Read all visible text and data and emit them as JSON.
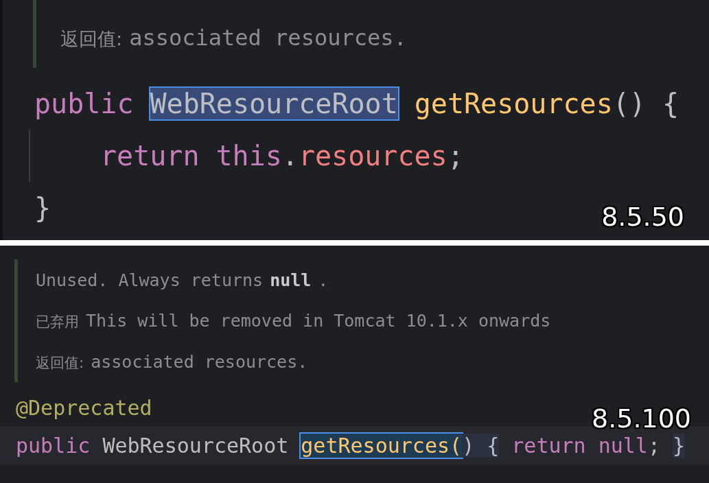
{
  "panels": [
    {
      "version": "8.5.50",
      "doc": [
        {
          "parts": [
            {
              "kind": "label",
              "text": "返回值:"
            },
            {
              "kind": "text",
              "text": "associated resources."
            }
          ]
        }
      ],
      "code": [
        {
          "indent": false,
          "current": false,
          "tokens": [
            {
              "kind": "keyword",
              "text": "public",
              "gap": false,
              "selected": false,
              "folded": false
            },
            {
              "kind": "type",
              "text": "WebResourceRoot",
              "gap": true,
              "selected": true,
              "folded": false
            },
            {
              "kind": "method",
              "text": "getResources",
              "gap": true,
              "selected": false,
              "folded": false
            },
            {
              "kind": "punct",
              "text": "()",
              "gap": false,
              "selected": false,
              "folded": false
            },
            {
              "kind": "punct",
              "text": "{",
              "gap": true,
              "selected": false,
              "folded": false
            }
          ]
        },
        {
          "indent": true,
          "current": false,
          "tokens": [
            {
              "kind": "keyword",
              "text": "return",
              "gap": false,
              "selected": false,
              "folded": false
            },
            {
              "kind": "keyword",
              "text": "this",
              "gap": true,
              "selected": false,
              "folded": false
            },
            {
              "kind": "punct",
              "text": ".",
              "gap": false,
              "selected": false,
              "folded": false
            },
            {
              "kind": "field",
              "text": "resources",
              "gap": false,
              "selected": false,
              "folded": false
            },
            {
              "kind": "punct",
              "text": ";",
              "gap": false,
              "selected": false,
              "folded": false
            }
          ]
        },
        {
          "indent": false,
          "current": false,
          "tokens": [
            {
              "kind": "punct",
              "text": "}",
              "gap": false,
              "selected": false,
              "folded": false
            }
          ]
        }
      ]
    },
    {
      "version": "8.5.100",
      "doc": [
        {
          "parts": [
            {
              "kind": "text",
              "text": "Unused. Always returns"
            },
            {
              "kind": "code",
              "text": "null"
            },
            {
              "kind": "text",
              "text": "."
            }
          ]
        },
        {
          "parts": [
            {
              "kind": "label",
              "text": "已弃用"
            },
            {
              "kind": "text",
              "text": "This will be removed in Tomcat 10.1.x onwards"
            }
          ]
        },
        {
          "parts": [
            {
              "kind": "label",
              "text": "返回值:"
            },
            {
              "kind": "text",
              "text": "associated resources."
            }
          ]
        }
      ],
      "code": [
        {
          "indent": false,
          "current": false,
          "tokens": [
            {
              "kind": "annotation",
              "text": "@Deprecated",
              "gap": false,
              "selected": false,
              "folded": false
            }
          ]
        },
        {
          "indent": false,
          "current": true,
          "tokens": [
            {
              "kind": "keyword",
              "text": "public",
              "gap": false,
              "selected": false,
              "folded": false
            },
            {
              "kind": "plain",
              "text": "WebResourceRoot",
              "gap": true,
              "selected": false,
              "folded": false
            },
            {
              "kind": "method",
              "text": "getResources(",
              "gap": true,
              "selected": true,
              "folded": false
            },
            {
              "kind": "punct",
              "text": ") {",
              "gap": false,
              "selected": false,
              "folded": true
            },
            {
              "kind": "keyword",
              "text": "return",
              "gap": true,
              "selected": false,
              "folded": false
            },
            {
              "kind": "keyword",
              "text": "null",
              "gap": true,
              "selected": false,
              "folded": false
            },
            {
              "kind": "punct",
              "text": ";",
              "gap": false,
              "selected": false,
              "folded": false
            },
            {
              "kind": "punct",
              "text": "}",
              "gap": true,
              "selected": false,
              "folded": true
            }
          ]
        }
      ]
    }
  ]
}
